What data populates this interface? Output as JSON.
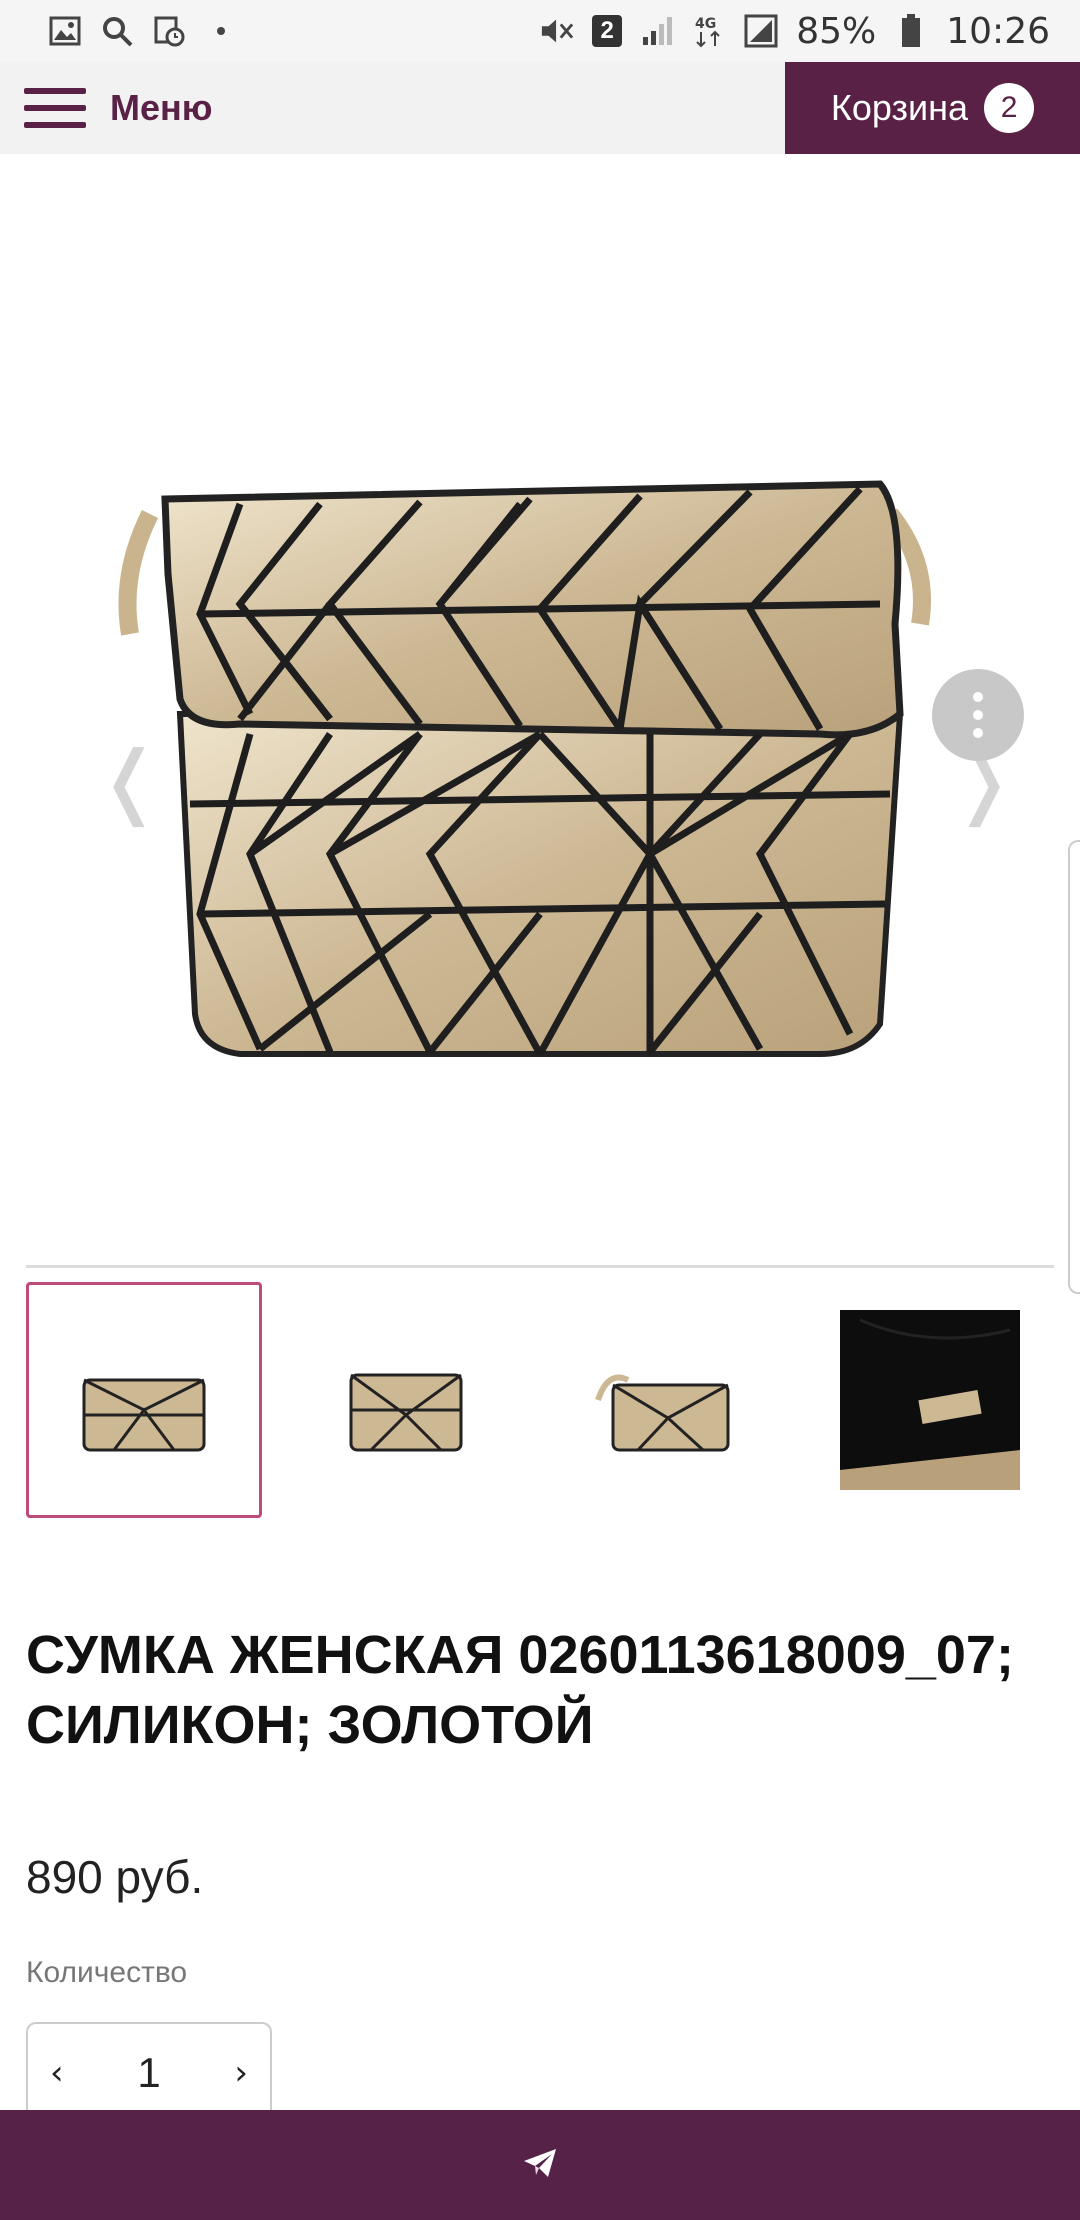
{
  "status_bar": {
    "battery": "85%",
    "time": "10:26",
    "notification_badge": "2",
    "network_label": "4G",
    "icons": [
      "image-icon",
      "search-icon",
      "schedule-icon",
      "dot-icon",
      "mute-icon",
      "sim-badge-icon",
      "signal-icon",
      "network-icon",
      "signal-bars-icon",
      "battery-icon"
    ]
  },
  "header": {
    "menu_label": "Меню",
    "cart_label": "Корзина",
    "cart_count": "2",
    "accent_color": "#5a2147"
  },
  "gallery": {
    "prev_arrow": "❬",
    "next_arrow": "❭",
    "thumbnails": [
      {
        "label": "thumbnail-1",
        "active": true
      },
      {
        "label": "thumbnail-2",
        "active": false
      },
      {
        "label": "thumbnail-3",
        "active": false
      },
      {
        "label": "thumbnail-4-interior",
        "active": false
      }
    ]
  },
  "product": {
    "title": "СУМКА ЖЕНСКАЯ 0260113618009_07; СИЛИКОН; ЗОЛОТОЙ",
    "price": "890 руб.",
    "quantity_label": "Количество",
    "quantity_value": "1",
    "decrement": "‹",
    "increment": "›"
  },
  "bottom_bar": {
    "icon": "telegram-send-icon",
    "color": "#562247"
  }
}
